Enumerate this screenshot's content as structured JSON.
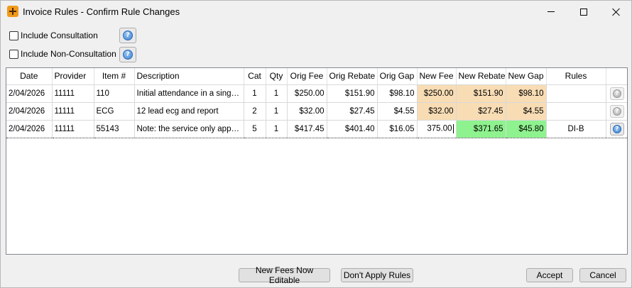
{
  "window": {
    "title": "Invoice Rules - Confirm Rule Changes",
    "minimize_icon": "minimize-icon",
    "maximize_icon": "maximize-icon",
    "close_icon": "close-icon"
  },
  "options": {
    "include_consultation": {
      "label": "Include Consultation",
      "checked": false
    },
    "include_non_consultation": {
      "label": "Include Non-Consultation",
      "checked": false
    },
    "help_glyph": "?"
  },
  "grid": {
    "columns": [
      "Date",
      "Provider",
      "Item #",
      "Description",
      "Cat",
      "Qty",
      "Orig Fee",
      "Orig Rebate",
      "Orig Gap",
      "New Fee",
      "New Rebate",
      "New Gap",
      "Rules",
      ""
    ],
    "rows": [
      {
        "date": "2/04/2026",
        "provider": "11111",
        "item": "110",
        "description": "Initial attendance in a single course of treatment",
        "cat": "1",
        "qty": "1",
        "orig_fee": "$250.00",
        "orig_rebate": "$151.90",
        "orig_gap": "$98.10",
        "new_fee": "$250.00",
        "new_rebate": "$151.90",
        "new_gap": "$98.10",
        "rules": ""
      },
      {
        "date": "2/04/2026",
        "provider": "11111",
        "item": "ECG",
        "description": "12 lead ecg and report",
        "cat": "2",
        "qty": "1",
        "orig_fee": "$32.00",
        "orig_rebate": "$27.45",
        "orig_gap": "$4.55",
        "new_fee": "$32.00",
        "new_rebate": "$27.45",
        "new_gap": "$4.55",
        "rules": ""
      },
      {
        "date": "2/04/2026",
        "provider": "11111",
        "item": "55143",
        "description": "Note: the service only applies when",
        "cat": "5",
        "qty": "1",
        "orig_fee": "$417.45",
        "orig_rebate": "$401.40",
        "orig_gap": "$16.05",
        "new_fee": "375.00",
        "new_rebate": "$371.65",
        "new_gap": "$45.80",
        "rules": "DI-B"
      }
    ]
  },
  "colors": {
    "unchanged_new_value": "#f7dcb4",
    "changed_new_value": "#8ef28e"
  },
  "buttons": {
    "new_fees_editable": "New Fees Now Editable",
    "dont_apply_rules": "Don't Apply Rules",
    "accept": "Accept",
    "cancel": "Cancel"
  }
}
